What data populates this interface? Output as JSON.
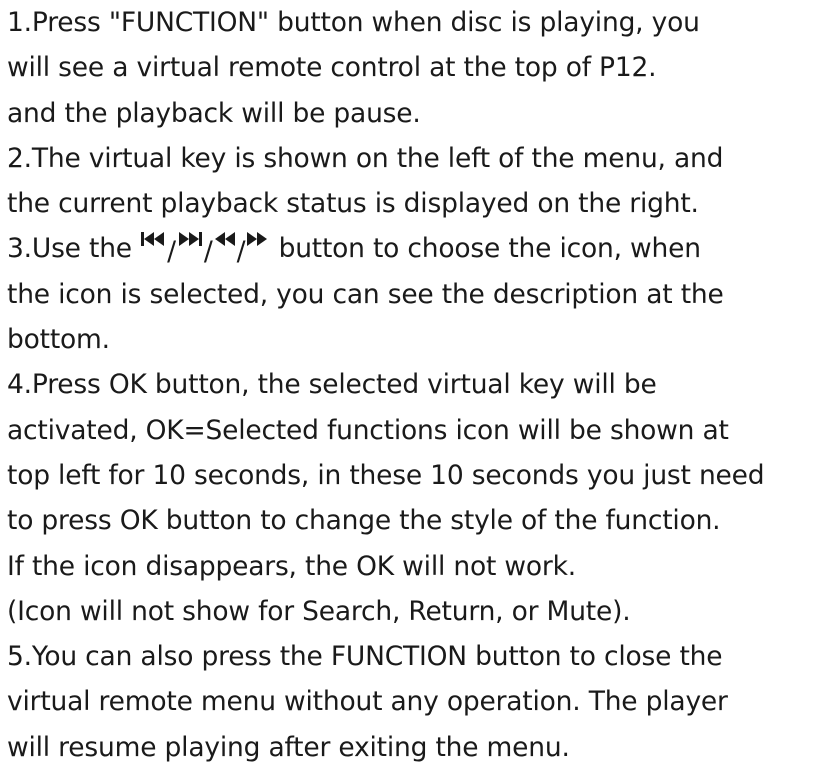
{
  "instructions": {
    "lines": [
      "1.Press \"FUNCTION\" button when disc is playing, you",
      "will see a virtual remote control at the top of P12.",
      "and the playback will be pause.",
      "2.The virtual key is shown on the left of the menu, and",
      "the current playback status is displayed on the right."
    ],
    "step3_prefix": "3.Use the",
    "step3_separator": "/",
    "step3_suffix": " button to choose the icon, when",
    "step3_icons": [
      "prev-track-icon",
      "next-track-icon",
      "rewind-icon",
      "fast-forward-icon"
    ],
    "lines_after": [
      "the icon is selected, you can see the description at the",
      "bottom.",
      "4.Press OK button, the selected virtual key will be",
      "activated, OK=Selected functions icon will be shown at",
      "top left for 10 seconds, in these 10 seconds you just need",
      "to press OK button to change the style of the function.",
      "If the icon disappears, the OK will not work.",
      "(Icon will not show for Search, Return, or Mute).",
      "5.You can also press the FUNCTION button to close the",
      "virtual remote menu without any operation. The player",
      "will resume playing after exiting the menu."
    ]
  }
}
